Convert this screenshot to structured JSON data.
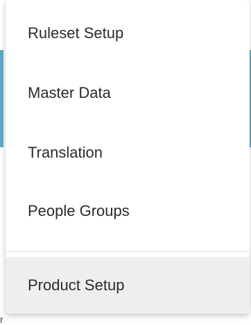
{
  "menu": {
    "items": [
      {
        "label": "Ruleset Setup"
      },
      {
        "label": "Master Data"
      },
      {
        "label": "Translation"
      },
      {
        "label": "People Groups"
      }
    ],
    "highlighted_item": {
      "label": "Product Setup"
    }
  },
  "background": {
    "peek_text": "r",
    "accent_color": "#5fa8c7"
  }
}
